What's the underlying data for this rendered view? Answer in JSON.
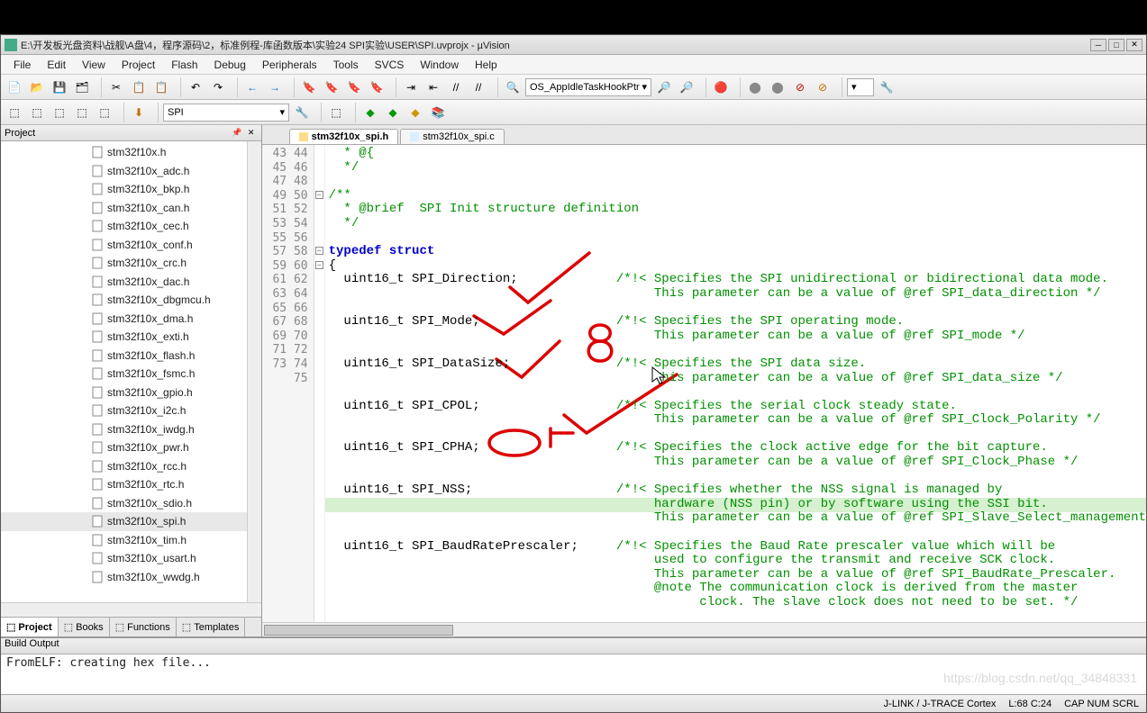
{
  "window": {
    "title": "E:\\开发板光盘资料\\战舰\\A盘\\4，程序源码\\2，标准例程-库函数版本\\实验24 SPI实验\\USER\\SPI.uvprojx - µVision"
  },
  "menu": [
    "File",
    "Edit",
    "View",
    "Project",
    "Flash",
    "Debug",
    "Peripherals",
    "Tools",
    "SVCS",
    "Window",
    "Help"
  ],
  "toolbar": {
    "combo1": "OS_AppIdleTaskHookPtr",
    "search": "SPI"
  },
  "sidebar": {
    "title": "Project",
    "items": [
      "stm32f10x.h",
      "stm32f10x_adc.h",
      "stm32f10x_bkp.h",
      "stm32f10x_can.h",
      "stm32f10x_cec.h",
      "stm32f10x_conf.h",
      "stm32f10x_crc.h",
      "stm32f10x_dac.h",
      "stm32f10x_dbgmcu.h",
      "stm32f10x_dma.h",
      "stm32f10x_exti.h",
      "stm32f10x_flash.h",
      "stm32f10x_fsmc.h",
      "stm32f10x_gpio.h",
      "stm32f10x_i2c.h",
      "stm32f10x_iwdg.h",
      "stm32f10x_pwr.h",
      "stm32f10x_rcc.h",
      "stm32f10x_rtc.h",
      "stm32f10x_sdio.h",
      "stm32f10x_spi.h",
      "stm32f10x_tim.h",
      "stm32f10x_usart.h",
      "stm32f10x_wwdg.h"
    ],
    "selected": 20,
    "tabs": [
      "Project",
      "Books",
      "Functions",
      "Templates"
    ]
  },
  "editor": {
    "tabs": [
      {
        "label": "stm32f10x_spi.h",
        "active": true
      },
      {
        "label": "stm32f10x_spi.c",
        "active": false
      }
    ],
    "first_line": 43,
    "last_line": 75,
    "highlight_line": 68,
    "lines": [
      {
        "n": 43,
        "code": "  * @{",
        "cls": "cm"
      },
      {
        "n": 44,
        "code": "  */",
        "cls": "cm"
      },
      {
        "n": 45,
        "code": "",
        "cls": ""
      },
      {
        "n": 46,
        "code": "/**",
        "cls": "cm"
      },
      {
        "n": 47,
        "code": "  * @brief  SPI Init structure definition",
        "cls": "cm"
      },
      {
        "n": 48,
        "code": "  */",
        "cls": "cm"
      },
      {
        "n": 49,
        "code": "",
        "cls": ""
      },
      {
        "n": 50,
        "code": "typedef struct",
        "cls": "kw"
      },
      {
        "n": 51,
        "code": "{",
        "cls": ""
      },
      {
        "n": 52,
        "code": "  uint16_t SPI_Direction;",
        "cmt": "/*!< Specifies the SPI unidirectional or bidirectional data mode."
      },
      {
        "n": 53,
        "code": "",
        "cmt": "     This parameter can be a value of @ref SPI_data_direction */"
      },
      {
        "n": 54,
        "code": "",
        "cls": ""
      },
      {
        "n": 55,
        "code": "  uint16_t SPI_Mode;",
        "cmt": "/*!< Specifies the SPI operating mode."
      },
      {
        "n": 56,
        "code": "",
        "cmt": "     This parameter can be a value of @ref SPI_mode */"
      },
      {
        "n": 57,
        "code": "",
        "cls": ""
      },
      {
        "n": 58,
        "code": "  uint16_t SPI_DataSize;",
        "cmt": "/*!< Specifies the SPI data size."
      },
      {
        "n": 59,
        "code": "",
        "cmt": "     This parameter can be a value of @ref SPI_data_size */"
      },
      {
        "n": 60,
        "code": "",
        "cls": ""
      },
      {
        "n": 61,
        "code": "  uint16_t SPI_CPOL;",
        "cmt": "/*!< Specifies the serial clock steady state."
      },
      {
        "n": 62,
        "code": "",
        "cmt": "     This parameter can be a value of @ref SPI_Clock_Polarity */"
      },
      {
        "n": 63,
        "code": "",
        "cls": ""
      },
      {
        "n": 64,
        "code": "  uint16_t SPI_CPHA;",
        "cmt": "/*!< Specifies the clock active edge for the bit capture."
      },
      {
        "n": 65,
        "code": "",
        "cmt": "     This parameter can be a value of @ref SPI_Clock_Phase */"
      },
      {
        "n": 66,
        "code": "",
        "cls": ""
      },
      {
        "n": 67,
        "code": "  uint16_t SPI_NSS;",
        "cmt": "/*!< Specifies whether the NSS signal is managed by"
      },
      {
        "n": 68,
        "code": "",
        "cmt": "     hardware (NSS pin) or by software using the SSI bit."
      },
      {
        "n": 69,
        "code": "",
        "cmt": "     This parameter can be a value of @ref SPI_Slave_Select_management"
      },
      {
        "n": 70,
        "code": "",
        "cls": ""
      },
      {
        "n": 71,
        "code": "  uint16_t SPI_BaudRatePrescaler;",
        "cmt": "/*!< Specifies the Baud Rate prescaler value which will be"
      },
      {
        "n": 72,
        "code": "",
        "cmt": "     used to configure the transmit and receive SCK clock."
      },
      {
        "n": 73,
        "code": "",
        "cmt": "     This parameter can be a value of @ref SPI_BaudRate_Prescaler."
      },
      {
        "n": 74,
        "code": "",
        "cmt": "     @note The communication clock is derived from the master"
      },
      {
        "n": 75,
        "code": "",
        "cmt": "           clock. The slave clock does not need to be set. */"
      }
    ]
  },
  "build": {
    "title": "Build Output",
    "text": "FromELF: creating hex file..."
  },
  "status": {
    "left": "",
    "debugger": "J-LINK / J-TRACE Cortex",
    "pos": "L:68 C:24",
    "caps": "CAP  NUM  SCRL"
  },
  "watermark": "https://blog.csdn.net/qq_34848331"
}
